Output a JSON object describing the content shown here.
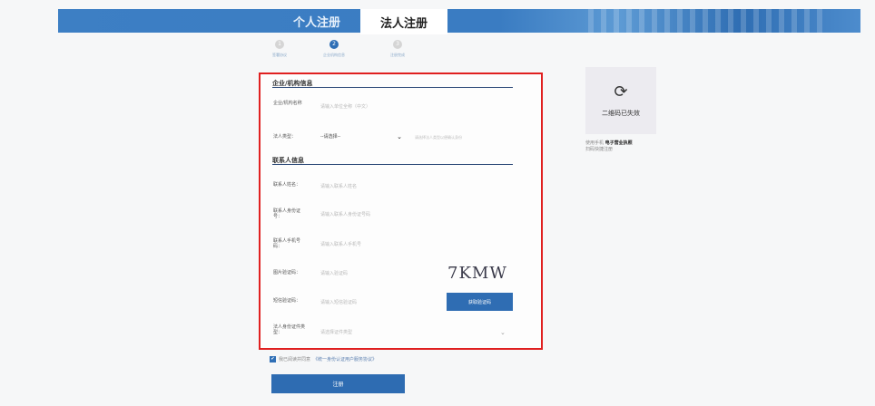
{
  "tabs": [
    {
      "label": "个人注册"
    },
    {
      "label": "法人注册"
    }
  ],
  "steps": [
    {
      "num": "1",
      "label": "签署协议"
    },
    {
      "num": "2",
      "label": "企业机构信息"
    },
    {
      "num": "3",
      "label": "注册完成"
    }
  ],
  "sections": {
    "org_title": "企业/机构信息",
    "contact_title": "联系人信息"
  },
  "fields": {
    "org_name": {
      "label": "企业/机构名称",
      "placeholder": "请输入单位全称（中文）"
    },
    "legal_type": {
      "label": "法人类型：",
      "value": "--请选择--",
      "hint": "请选择法人类型以便确认身份"
    },
    "contact_name": {
      "label": "联系人姓名：",
      "placeholder": "请输入联系人姓名"
    },
    "contact_id": {
      "label": "联系人身份证号：",
      "placeholder": "请输入联系人身份证号码"
    },
    "contact_phone": {
      "label": "联系人手机号码：",
      "placeholder": "请输入联系人手机号"
    },
    "image_code": {
      "label": "图片验证码：",
      "placeholder": "请输入验证码"
    },
    "sms_code": {
      "label": "短信验证码：",
      "placeholder": "请输入短信验证码"
    },
    "legal_id_type": {
      "label": "法人身份证件类型：",
      "placeholder": "请选择证件类型"
    }
  },
  "captcha_text": "7KMW",
  "sms_button": "获取验证码",
  "agree": {
    "checkbox": "✔",
    "text": "我已阅读并同意",
    "link": "《统一身份认证用户服务协议》"
  },
  "register_button": "注册",
  "qr": {
    "icon": "refresh-icon",
    "status": "二维码已失效",
    "caption_prefix": "使用手机",
    "caption_app": "电子营业执照",
    "caption_suffix": "扫码快捷注册"
  },
  "colors": {
    "accent": "#2e6cb2",
    "highlight_border": "#e02020"
  }
}
